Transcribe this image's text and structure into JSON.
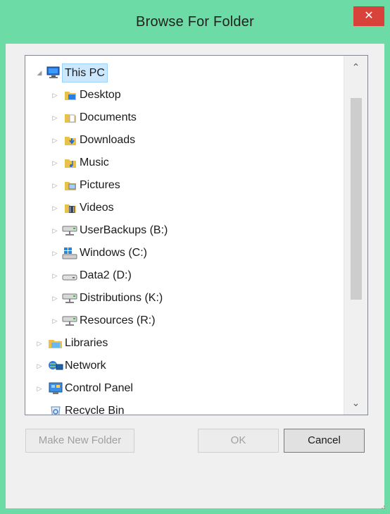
{
  "window": {
    "title": "Browse For Folder",
    "close_glyph": "✕"
  },
  "tree": {
    "items": [
      {
        "label": "This PC",
        "icon": "this-pc-icon",
        "expanded": true,
        "selected": true
      },
      {
        "label": "Desktop",
        "icon": "desktop-folder-icon"
      },
      {
        "label": "Documents",
        "icon": "documents-folder-icon"
      },
      {
        "label": "Downloads",
        "icon": "downloads-folder-icon"
      },
      {
        "label": "Music",
        "icon": "music-folder-icon"
      },
      {
        "label": "Pictures",
        "icon": "pictures-folder-icon"
      },
      {
        "label": "Videos",
        "icon": "videos-folder-icon"
      },
      {
        "label": "UserBackups (B:)",
        "icon": "network-drive-icon"
      },
      {
        "label": "Windows (C:)",
        "icon": "windows-drive-icon"
      },
      {
        "label": "Data2 (D:)",
        "icon": "hard-drive-icon"
      },
      {
        "label": "Distributions (K:)",
        "icon": "network-drive-icon"
      },
      {
        "label": "Resources (R:)",
        "icon": "network-drive-icon"
      },
      {
        "label": "Libraries",
        "icon": "libraries-icon"
      },
      {
        "label": "Network",
        "icon": "network-icon"
      },
      {
        "label": "Control Panel",
        "icon": "control-panel-icon"
      },
      {
        "label": "Recycle Bin",
        "icon": "recycle-bin-icon"
      }
    ]
  },
  "buttons": {
    "make_new_folder": "Make New Folder",
    "ok": "OK",
    "cancel": "Cancel"
  },
  "colors": {
    "frame": "#6ddba6",
    "close": "#d9413b",
    "selection": "#cce8ff"
  }
}
